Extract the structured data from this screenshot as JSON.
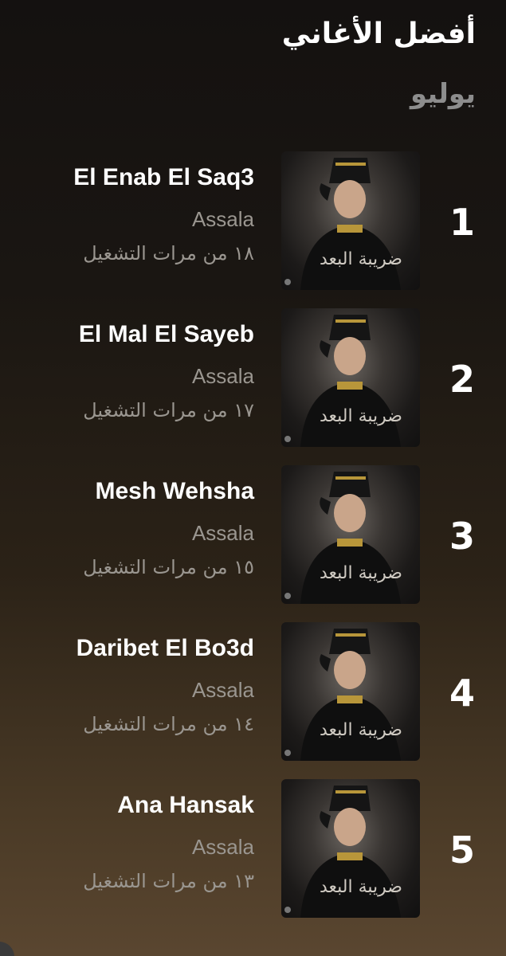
{
  "header": {
    "title": "أفضل الأغاني",
    "subtitle": "يوليو"
  },
  "songs": [
    {
      "rank": "1",
      "title": "El Enab El Saq3",
      "artist": "Assala",
      "plays": "١٨ من مرات التشغيل"
    },
    {
      "rank": "2",
      "title": "El Mal El Sayeb",
      "artist": "Assala",
      "plays": "١٧ من مرات التشغيل"
    },
    {
      "rank": "3",
      "title": "Mesh Wehsha",
      "artist": "Assala",
      "plays": "١٥ من مرات التشغيل"
    },
    {
      "rank": "4",
      "title": "Daribet El Bo3d",
      "artist": "Assala",
      "plays": "١٤ من مرات التشغيل"
    },
    {
      "rank": "5",
      "title": "Ana Hansak",
      "artist": "Assala",
      "plays": "١٣ من مرات التشغيل"
    }
  ],
  "album_art": {
    "icon": "album-cover-portrait",
    "caption": "ضريبة البعد"
  },
  "colors": {
    "background_top": "#141110",
    "background_bottom": "#5a4630",
    "primary_text": "#ffffff",
    "secondary_text": "#9a9690",
    "subtitle_text": "#8d8d8d"
  }
}
